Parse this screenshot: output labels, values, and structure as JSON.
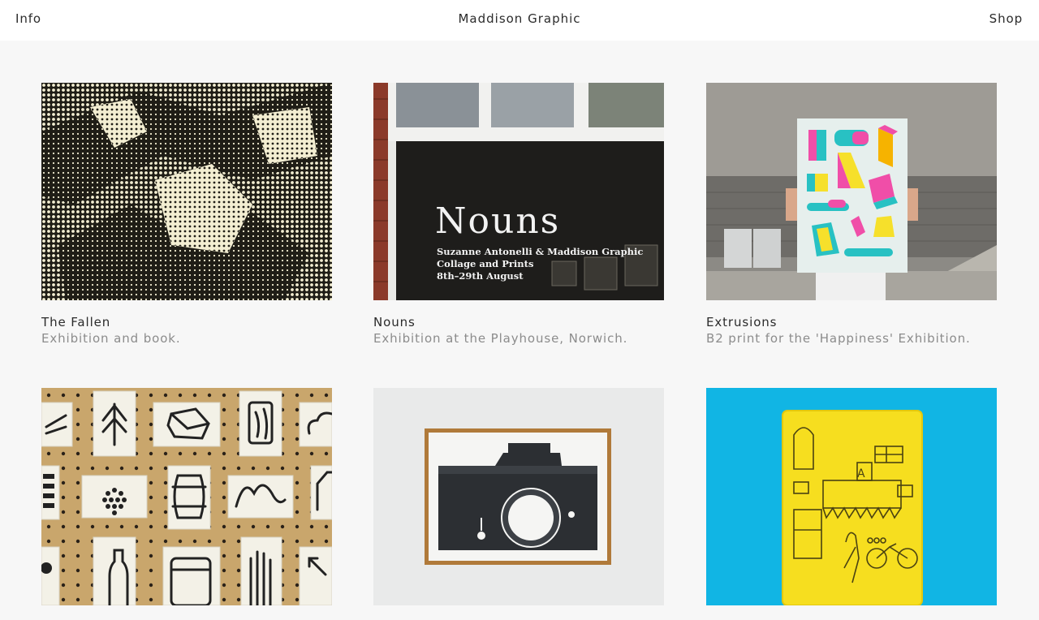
{
  "header": {
    "info_label": "Info",
    "site_title": "Maddison Graphic",
    "shop_label": "Shop"
  },
  "projects": [
    {
      "title": "The Fallen",
      "description": "Exhibition and book."
    },
    {
      "title": "Nouns",
      "description": "Exhibition at the Playhouse, Norwich.",
      "image_text": {
        "heading": "Nouns",
        "line1": "Suzanne Antonelli & Maddison Graphic",
        "line2": "Collage and Prints",
        "line3": "8th–29th August"
      }
    },
    {
      "title": "Extrusions",
      "description": "B2 print for the 'Happiness' Exhibition."
    },
    {
      "title": "",
      "description": ""
    },
    {
      "title": "",
      "description": ""
    },
    {
      "title": "",
      "description": ""
    }
  ],
  "colors": {
    "background": "#f7f7f7",
    "header_bg": "#ffffff",
    "text": "#2b2b2b",
    "muted_text": "#8c8c8c"
  }
}
